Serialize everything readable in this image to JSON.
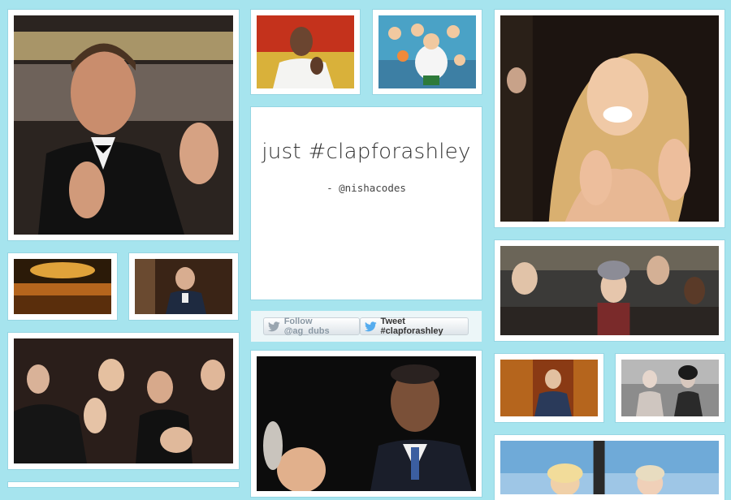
{
  "colors": {
    "background": "#a6e4ee",
    "tile_border": "#ffffff",
    "twitter_blue": "#55acee",
    "follow_bird_gray": "#9aa6b0"
  },
  "quote": {
    "text": "just #clapforashley",
    "author": "- @nishacodes"
  },
  "buttons": {
    "follow_label": "Follow @ag_dubs",
    "tweet_label": "Tweet #clapforashley"
  },
  "gallery": {
    "items": [
      "man-in-tuxedo-clapping-gif",
      "man-in-white-shirt-clapping-gif",
      "cartoon-crowd-clapping-gif",
      "blonde-woman-laughing-clapping-gif",
      "concert-crowd-gif",
      "student-in-blazer-clapping-gif",
      "students-cheering-gif",
      "audience-applauding-gif",
      "man-in-suit-smiling-clapping-gif",
      "talk-show-guest-clapping-gif",
      "two-people-clapping-gif",
      "talk-show-hosts-gif"
    ]
  }
}
